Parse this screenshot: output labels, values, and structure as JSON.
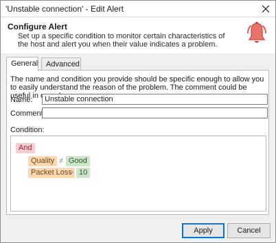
{
  "window": {
    "title": "'Unstable connection' - Edit Alert",
    "close_icon": "close-icon"
  },
  "header": {
    "title": "Configure Alert",
    "description": "Set up a specific condition to monitor certain characteristics of the host and alert you when their value indicates a problem.",
    "icon": "bell-icon",
    "icon_color": "#e05a52"
  },
  "tabs": [
    {
      "label": "General",
      "active": true
    },
    {
      "label": "Advanced",
      "active": false
    }
  ],
  "general": {
    "intro": "The name and condition you provide should be specific enough to allow you to easily understand the reason of the problem. The comment could be useful in complex cases.",
    "name_label": "Name:",
    "name_value": "Unstable connection",
    "comment_label": "Comment:",
    "comment_value": "",
    "condition_label": "Condition:"
  },
  "condition": {
    "root": "And",
    "rules": [
      {
        "field": "Quality",
        "operator": "≠",
        "value": "Good"
      },
      {
        "field": "Packet Loss",
        "operator": ">",
        "value": "10"
      }
    ]
  },
  "buttons": {
    "apply": "Apply",
    "cancel": "Cancel"
  }
}
